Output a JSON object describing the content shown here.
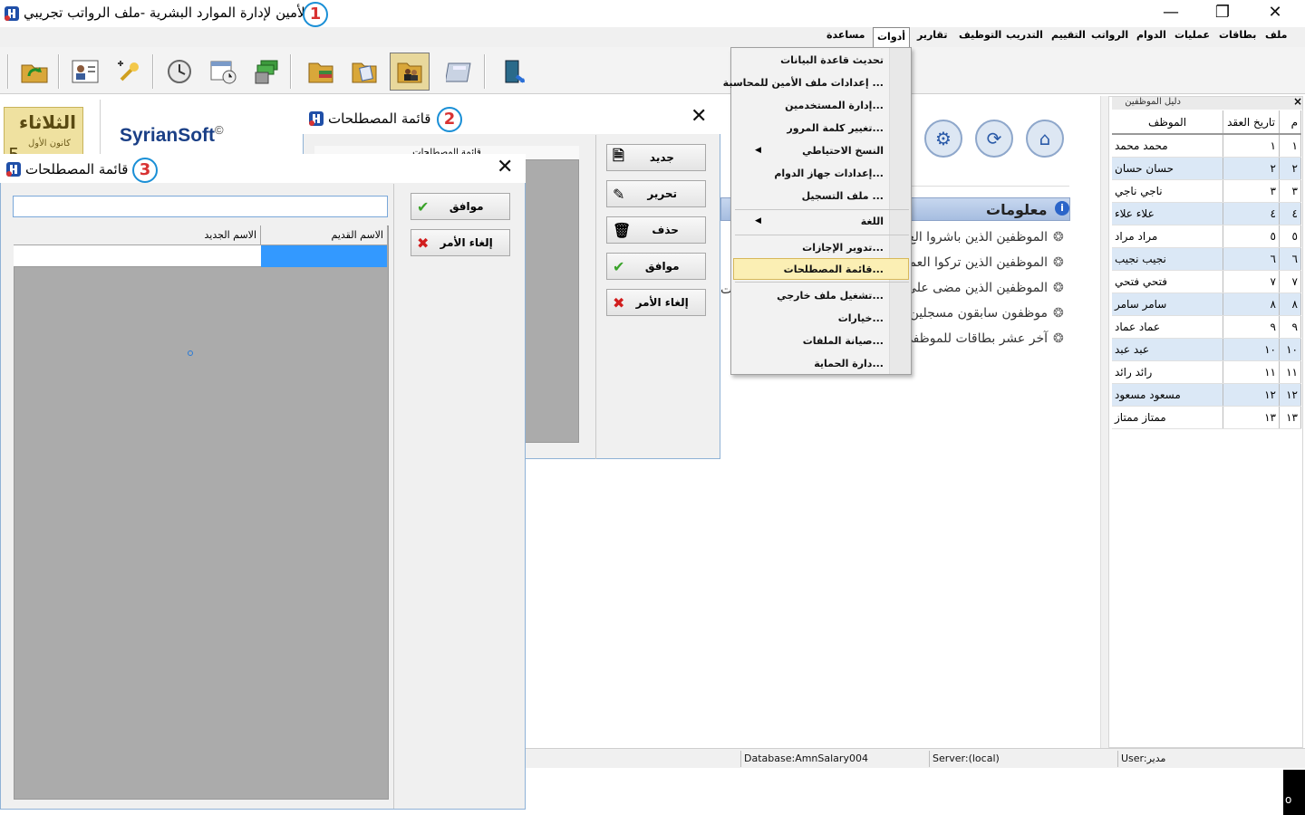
{
  "window": {
    "title": "الأمين لإدارة الموارد البشرية -ملف الرواتب تجريبي",
    "minimize": "—",
    "maximize": "❐",
    "close": "✕"
  },
  "badges": {
    "one": "1",
    "two": "2",
    "three": "3"
  },
  "menubar": [
    "ملف",
    "بطاقات",
    "عمليات",
    "الدوام",
    "الرواتب",
    "التقييم",
    "التدريب",
    "التوظيف",
    "تقارير",
    "أدوات",
    "مساعدة"
  ],
  "date_tile": {
    "day": "الثلاثاء",
    "month": "كانون الأول",
    "num": "5"
  },
  "brand": {
    "name": "SyrianSoft",
    "symbol": "©"
  },
  "info": {
    "title": "معلومات",
    "icon": "i",
    "lines": [
      "الموظفين الذين باشروا الع",
      "الموظفين الذين تركوا العم",
      "الموظفين الذين مضى على",
      "موظفون سابقون مسجلين",
      "آخر عشر بطاقات للموظفي"
    ],
    "cut_letter": "ت"
  },
  "employees_panel": {
    "title": "دليل الموظفين",
    "close": "×",
    "headers": {
      "num": "م",
      "contract": "تاريخ العقد",
      "employee": "الموظف"
    },
    "rows": [
      {
        "n": "١",
        "c": "١",
        "name": "محمد محمد"
      },
      {
        "n": "٢",
        "c": "٢",
        "name": "حسان حسان"
      },
      {
        "n": "٣",
        "c": "٣",
        "name": "ناجي ناجي"
      },
      {
        "n": "٤",
        "c": "٤",
        "name": "علاء علاء"
      },
      {
        "n": "٥",
        "c": "٥",
        "name": "مراد مراد"
      },
      {
        "n": "٦",
        "c": "٦",
        "name": "نجيب نجيب"
      },
      {
        "n": "٧",
        "c": "٧",
        "name": "فتحي فتحي"
      },
      {
        "n": "٨",
        "c": "٨",
        "name": "سامر سامر"
      },
      {
        "n": "٩",
        "c": "٩",
        "name": "عماد عماد"
      },
      {
        "n": "١٠",
        "c": "١٠",
        "name": "عبد عبد"
      },
      {
        "n": "١١",
        "c": "١١",
        "name": "رائد رائد"
      },
      {
        "n": "١٢",
        "c": "١٢",
        "name": "مسعود مسعود"
      },
      {
        "n": "١٣",
        "c": "١٣",
        "name": "ممتاز ممتاز"
      }
    ]
  },
  "status": {
    "database": "Database:AmnSalary004",
    "server": "Server:(local)",
    "user": "User:مدير",
    "corner": "o"
  },
  "tools_menu": {
    "items": [
      "تحديث قاعدة البيانات",
      "إعدادات ملف الأمين للمحاسبة ...",
      "إدارة المستخدمين...",
      "تغيير كلمة المرور...",
      "النسخ الاحتياطي",
      "إعدادات جهاز الدوام...",
      "ملف التسجيل ...",
      "اللغة",
      "تدوير الإجازات...",
      "قائمة المصطلحات...",
      "تشغيل ملف خارجي...",
      "خيارات...",
      "صيانة الملفات...",
      "دارة الحماية..."
    ],
    "submenu_arrow": "◀"
  },
  "dialog2": {
    "title": "قائمة المصطلحات",
    "close": "✕",
    "list_header": "قائمة المصطلحات",
    "buttons": {
      "new": "جديد",
      "edit": "تحرير",
      "delete": "حذف",
      "ok": "موافق",
      "cancel": "إلغاء الأمر"
    }
  },
  "dialog3": {
    "title": "قائمة المصطلحات",
    "close": "✕",
    "search_value": "",
    "columns": {
      "old": "الاسم القديم",
      "new": "الاسم الجديد"
    },
    "buttons": {
      "ok": "موافق",
      "cancel": "إلغاء الأمر"
    }
  },
  "icons": {
    "check": "✔",
    "cross": "✖",
    "new": "🗎",
    "edit": "✎",
    "delete": "🗑",
    "home": "⌂",
    "refresh": "⟳",
    "settings": "⚙",
    "bullet": "❂"
  },
  "colors": {
    "highlight": "#fbefb4",
    "selection": "#3399ff",
    "accent_badge": "#1a8fd6"
  }
}
